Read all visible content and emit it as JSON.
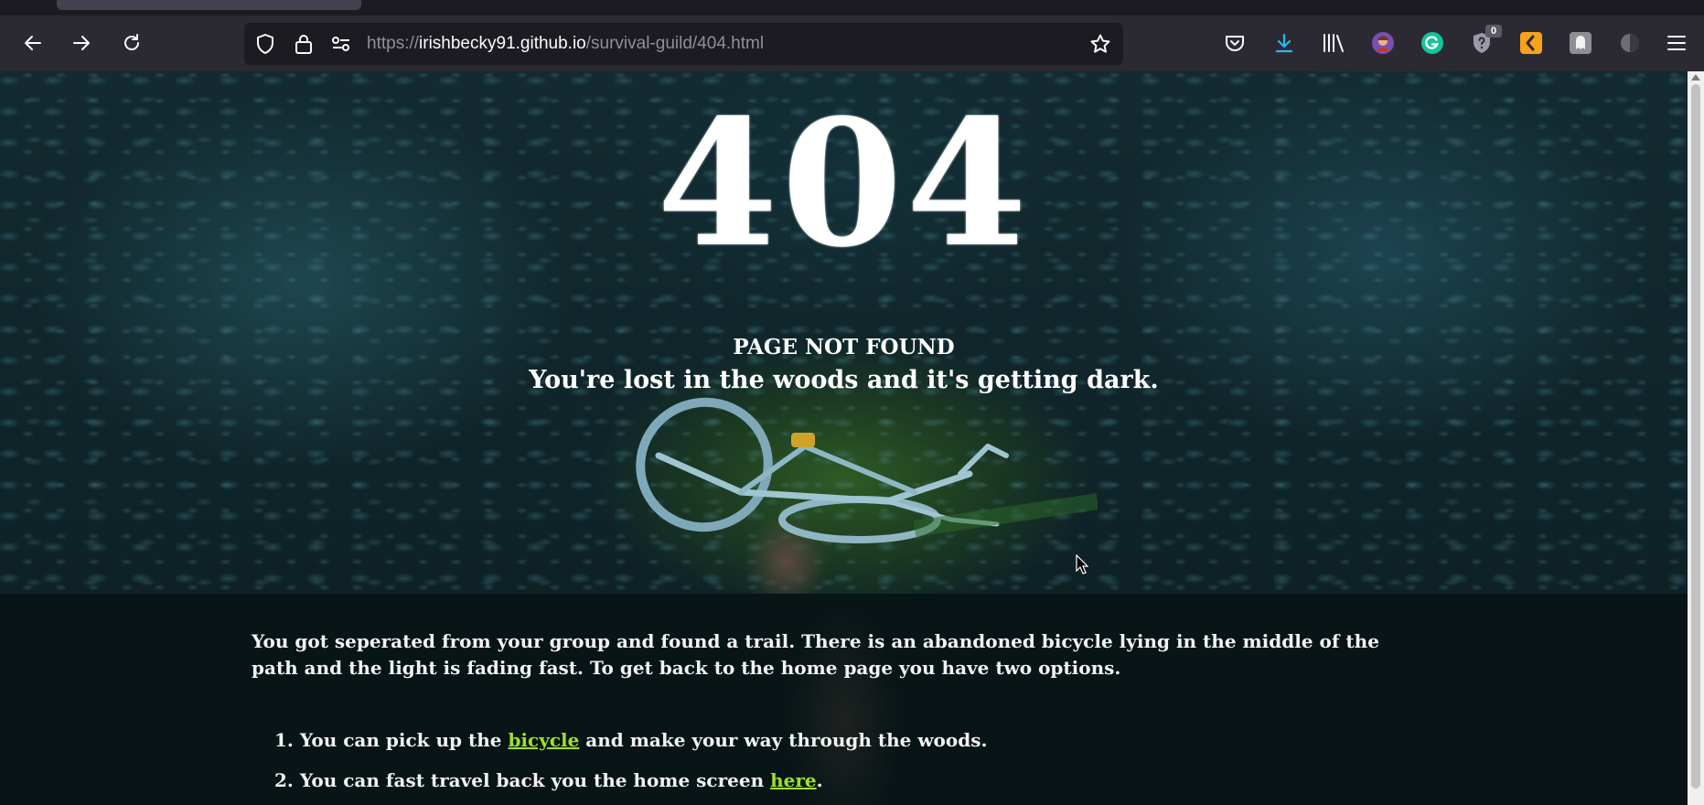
{
  "browser": {
    "url_prefix": "https://",
    "url_host": "irishbecky91.github.io",
    "url_path": "/survival-guild/404.html",
    "extension_badge": "0"
  },
  "page": {
    "code": "404",
    "subtitle": "PAGE NOT FOUND",
    "tagline": "You're lost in the woods and it's getting dark.",
    "intro": "You got seperated from your group and found a trail. There is an abandoned bicycle lying in the middle of the path and the light is fading fast. To get back to the home page you have two options.",
    "options": [
      {
        "number": "1.",
        "before": "You can pick up the",
        "link": "bicycle",
        "after": "and make your way through the woods."
      },
      {
        "number": "2.",
        "before": "You can fast travel back you the home screen",
        "link": "here",
        "after": "."
      }
    ],
    "link_color": "#9be227"
  }
}
